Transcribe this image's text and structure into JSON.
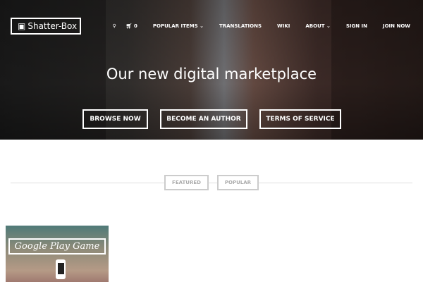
{
  "header": {
    "logo": "Shatter-Box",
    "cart_count": "0",
    "nav": [
      "POPULAR ITEMS",
      "TRANSLATIONS",
      "WIKI",
      "ABOUT",
      "SIGN IN",
      "JOIN NOW"
    ]
  },
  "hero": {
    "title": "Our new digital marketplace",
    "buttons": [
      "BROWSE NOW",
      "BECOME AN AUTHOR",
      "TERMS OF SERVICE"
    ]
  },
  "tabs": [
    "FEATURED",
    "POPULAR"
  ],
  "items": [
    {
      "title": "Google Play Game"
    }
  ]
}
